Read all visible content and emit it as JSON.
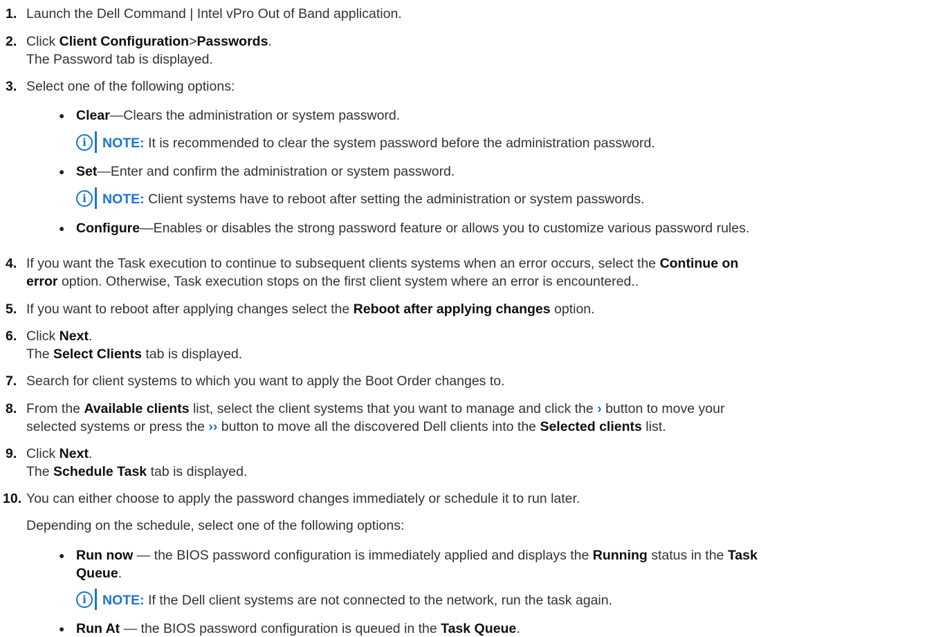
{
  "steps": {
    "s1": {
      "num": "1.",
      "text": "Launch the Dell Command | Intel vPro Out of Band application."
    },
    "s2": {
      "num": "2.",
      "pre": "Click ",
      "b1": "Client Configuration",
      "sep": ">",
      "b2": "Passwords",
      "post": ".",
      "line2": "The Password tab is displayed."
    },
    "s3": {
      "num": "3.",
      "text": "Select one of the following options:"
    },
    "s4": {
      "num": "4.",
      "pre": "If you want the Task execution to continue to subsequent clients systems when an error occurs, select the ",
      "b1": "Continue on",
      "b2": "error",
      "post": " option. Otherwise, Task execution stops on the first client system where an error is encountered.."
    },
    "s5": {
      "num": "5.",
      "pre": "If you want to reboot after applying changes select the ",
      "b1": "Reboot after applying changes",
      "post": " option."
    },
    "s6": {
      "num": "6.",
      "pre": "Click ",
      "b1": "Next",
      "post": ".",
      "l2pre": "The ",
      "l2b": "Select Clients",
      "l2post": " tab is displayed."
    },
    "s7": {
      "num": "7.",
      "text": "Search for client systems to which you want to apply the Boot Order changes to."
    },
    "s8": {
      "num": "8.",
      "pre": "From the ",
      "b1": "Available clients",
      "mid1": " list, select the client systems that you want to manage and click the ",
      "chev1": "›",
      "mid2": " button to move your",
      "l2pre": "selected systems or press the ",
      "chev2": "››",
      "l2mid": " button to move all the discovered Dell clients into the ",
      "l2b": "Selected clients",
      "l2post": " list."
    },
    "s9": {
      "num": "9.",
      "pre": "Click ",
      "b1": "Next",
      "post": ".",
      "l2pre": "The ",
      "l2b": "Schedule Task",
      "l2post": " tab is displayed."
    },
    "s10": {
      "num": "10.",
      "text": "You can either choose to apply the password changes immediately or schedule it to run later.",
      "line2": "Depending on the schedule, select one of the following options:"
    }
  },
  "options": {
    "clear": {
      "b": "Clear",
      "text": "—Clears the administration or system password."
    },
    "set": {
      "b": "Set",
      "text": "—Enter and confirm the administration or system password."
    },
    "configure": {
      "b": "Configure",
      "text": "—Enables or disables the strong password feature or allows you to customize various password rules."
    },
    "run_now": {
      "b": "Run now",
      "text": " — the BIOS password configuration is immediately applied and displays the ",
      "b2": "Running",
      "mid": " status in the ",
      "b3": "Task",
      "b4": "Queue",
      "post": "."
    },
    "run_at": {
      "b": "Run At",
      "text": " — the BIOS password configuration is queued in the ",
      "b2": "Task Queue",
      "post": "."
    }
  },
  "notes": {
    "label": "NOTE:",
    "icon_glyph": "i",
    "n1": " It is recommended to clear the system password before the administration password.",
    "n2": " Client systems have to reboot after setting the administration or system passwords.",
    "n3": " If the Dell client systems are not connected to the network, run the task again."
  },
  "bullet": "●",
  "colors": {
    "accent": "#1a73d3",
    "text": "#333333"
  }
}
